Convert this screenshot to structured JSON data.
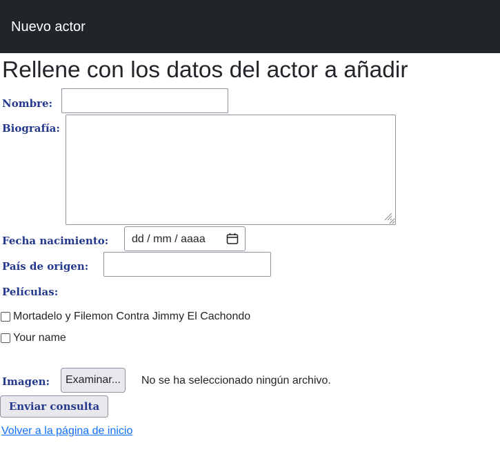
{
  "header": {
    "title": "Nuevo actor"
  },
  "page": {
    "heading": "Rellene con los datos del actor a añadir"
  },
  "form": {
    "nombre": {
      "label": "Nombre:",
      "value": ""
    },
    "biografia": {
      "label": "Biografía:",
      "value": ""
    },
    "fecha": {
      "label": "Fecha nacimiento:",
      "placeholder": "dd / mm / aaaa"
    },
    "pais": {
      "label": "País de origen:",
      "value": ""
    },
    "peliculas": {
      "label": "Películas:",
      "options": [
        {
          "label": "Mortadelo y Filemon Contra Jimmy El Cachondo",
          "checked": false
        },
        {
          "label": "Your name",
          "checked": false
        }
      ]
    },
    "imagen": {
      "label": "Imagen:",
      "button_label": "Examinar...",
      "status": "No se ha seleccionado ningún archivo."
    },
    "submit_label": "Enviar consulta"
  },
  "back_link": "Volver a la página de inicio",
  "colors": {
    "header_bg": "#212529",
    "label": "#24388d",
    "link": "#0d6efd"
  }
}
